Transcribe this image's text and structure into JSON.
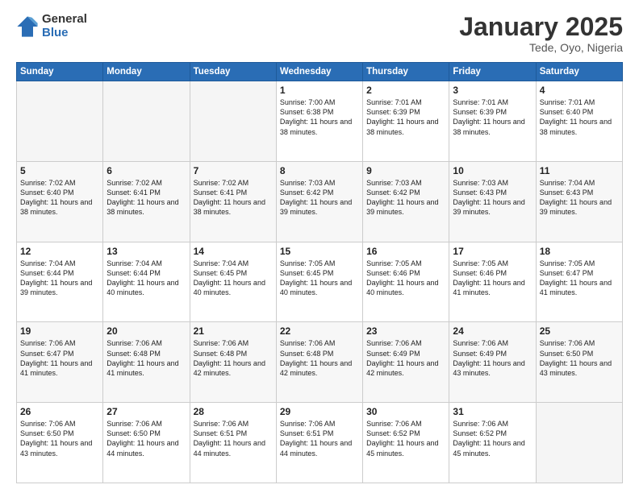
{
  "logo": {
    "general": "General",
    "blue": "Blue"
  },
  "title": "January 2025",
  "location": "Tede, Oyo, Nigeria",
  "weekdays": [
    "Sunday",
    "Monday",
    "Tuesday",
    "Wednesday",
    "Thursday",
    "Friday",
    "Saturday"
  ],
  "weeks": [
    [
      {
        "day": "",
        "empty": true
      },
      {
        "day": "",
        "empty": true
      },
      {
        "day": "",
        "empty": true
      },
      {
        "day": "1",
        "sunrise": "7:00 AM",
        "sunset": "6:38 PM",
        "daylight": "11 hours and 38 minutes."
      },
      {
        "day": "2",
        "sunrise": "7:01 AM",
        "sunset": "6:39 PM",
        "daylight": "11 hours and 38 minutes."
      },
      {
        "day": "3",
        "sunrise": "7:01 AM",
        "sunset": "6:39 PM",
        "daylight": "11 hours and 38 minutes."
      },
      {
        "day": "4",
        "sunrise": "7:01 AM",
        "sunset": "6:40 PM",
        "daylight": "11 hours and 38 minutes."
      }
    ],
    [
      {
        "day": "5",
        "sunrise": "7:02 AM",
        "sunset": "6:40 PM",
        "daylight": "11 hours and 38 minutes."
      },
      {
        "day": "6",
        "sunrise": "7:02 AM",
        "sunset": "6:41 PM",
        "daylight": "11 hours and 38 minutes."
      },
      {
        "day": "7",
        "sunrise": "7:02 AM",
        "sunset": "6:41 PM",
        "daylight": "11 hours and 38 minutes."
      },
      {
        "day": "8",
        "sunrise": "7:03 AM",
        "sunset": "6:42 PM",
        "daylight": "11 hours and 39 minutes."
      },
      {
        "day": "9",
        "sunrise": "7:03 AM",
        "sunset": "6:42 PM",
        "daylight": "11 hours and 39 minutes."
      },
      {
        "day": "10",
        "sunrise": "7:03 AM",
        "sunset": "6:43 PM",
        "daylight": "11 hours and 39 minutes."
      },
      {
        "day": "11",
        "sunrise": "7:04 AM",
        "sunset": "6:43 PM",
        "daylight": "11 hours and 39 minutes."
      }
    ],
    [
      {
        "day": "12",
        "sunrise": "7:04 AM",
        "sunset": "6:44 PM",
        "daylight": "11 hours and 39 minutes."
      },
      {
        "day": "13",
        "sunrise": "7:04 AM",
        "sunset": "6:44 PM",
        "daylight": "11 hours and 40 minutes."
      },
      {
        "day": "14",
        "sunrise": "7:04 AM",
        "sunset": "6:45 PM",
        "daylight": "11 hours and 40 minutes."
      },
      {
        "day": "15",
        "sunrise": "7:05 AM",
        "sunset": "6:45 PM",
        "daylight": "11 hours and 40 minutes."
      },
      {
        "day": "16",
        "sunrise": "7:05 AM",
        "sunset": "6:46 PM",
        "daylight": "11 hours and 40 minutes."
      },
      {
        "day": "17",
        "sunrise": "7:05 AM",
        "sunset": "6:46 PM",
        "daylight": "11 hours and 41 minutes."
      },
      {
        "day": "18",
        "sunrise": "7:05 AM",
        "sunset": "6:47 PM",
        "daylight": "11 hours and 41 minutes."
      }
    ],
    [
      {
        "day": "19",
        "sunrise": "7:06 AM",
        "sunset": "6:47 PM",
        "daylight": "11 hours and 41 minutes."
      },
      {
        "day": "20",
        "sunrise": "7:06 AM",
        "sunset": "6:48 PM",
        "daylight": "11 hours and 41 minutes."
      },
      {
        "day": "21",
        "sunrise": "7:06 AM",
        "sunset": "6:48 PM",
        "daylight": "11 hours and 42 minutes."
      },
      {
        "day": "22",
        "sunrise": "7:06 AM",
        "sunset": "6:48 PM",
        "daylight": "11 hours and 42 minutes."
      },
      {
        "day": "23",
        "sunrise": "7:06 AM",
        "sunset": "6:49 PM",
        "daylight": "11 hours and 42 minutes."
      },
      {
        "day": "24",
        "sunrise": "7:06 AM",
        "sunset": "6:49 PM",
        "daylight": "11 hours and 43 minutes."
      },
      {
        "day": "25",
        "sunrise": "7:06 AM",
        "sunset": "6:50 PM",
        "daylight": "11 hours and 43 minutes."
      }
    ],
    [
      {
        "day": "26",
        "sunrise": "7:06 AM",
        "sunset": "6:50 PM",
        "daylight": "11 hours and 43 minutes."
      },
      {
        "day": "27",
        "sunrise": "7:06 AM",
        "sunset": "6:50 PM",
        "daylight": "11 hours and 44 minutes."
      },
      {
        "day": "28",
        "sunrise": "7:06 AM",
        "sunset": "6:51 PM",
        "daylight": "11 hours and 44 minutes."
      },
      {
        "day": "29",
        "sunrise": "7:06 AM",
        "sunset": "6:51 PM",
        "daylight": "11 hours and 44 minutes."
      },
      {
        "day": "30",
        "sunrise": "7:06 AM",
        "sunset": "6:52 PM",
        "daylight": "11 hours and 45 minutes."
      },
      {
        "day": "31",
        "sunrise": "7:06 AM",
        "sunset": "6:52 PM",
        "daylight": "11 hours and 45 minutes."
      },
      {
        "day": "",
        "empty": true
      }
    ]
  ]
}
